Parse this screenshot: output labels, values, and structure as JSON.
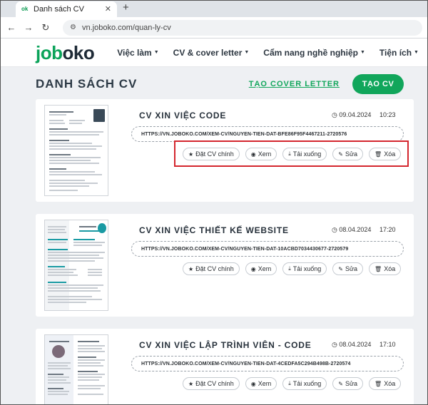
{
  "browser": {
    "tab_title": "Danh sách CV",
    "favicon": "ok",
    "url": "vn.joboko.com/quan-ly-cv"
  },
  "site": {
    "logo_prefix": "job",
    "logo_suffix": "oko",
    "nav": [
      "Việc làm",
      "CV & cover letter",
      "Cẩm nang nghề nghiệp",
      "Tiện ích"
    ]
  },
  "page": {
    "title": "DANH SÁCH CV",
    "cover_letter_link": "TẠO COVER LETTER",
    "create_button": "TẠO CV"
  },
  "actions": {
    "set_main": "Đặt CV chính",
    "view": "Xem",
    "download": "Tải xuống",
    "edit": "Sửa",
    "delete": "Xóa"
  },
  "cvs": [
    {
      "name": "CV XIN VIỆC CODE",
      "date": "09.04.2024",
      "time": "10:23",
      "link": "HTTPS://VN.JOBOKO.COM/XEM-CV/NGUYEN-TIEN-DAT-BFE86F95F4467211-2720576"
    },
    {
      "name": "CV XIN VIỆC THIẾT KẾ WEBSITE",
      "date": "08.04.2024",
      "time": "17:20",
      "link": "HTTPS://VN.JOBOKO.COM/XEM-CV/NGUYEN-TIEN-DAT-10ACBD7034430677-2720579"
    },
    {
      "name": "CV XIN VIỆC LẬP TRÌNH VIÊN - CODE",
      "date": "08.04.2024",
      "time": "17:10",
      "link": "HTTPS://VN.JOBOKO.COM/XEM-CV/NGUYEN-TIEN-DAT-4CEDFA5C294B498B-2720574"
    }
  ],
  "colors": {
    "brand_green": "#11a65b",
    "highlight_red": "#d4262e"
  }
}
